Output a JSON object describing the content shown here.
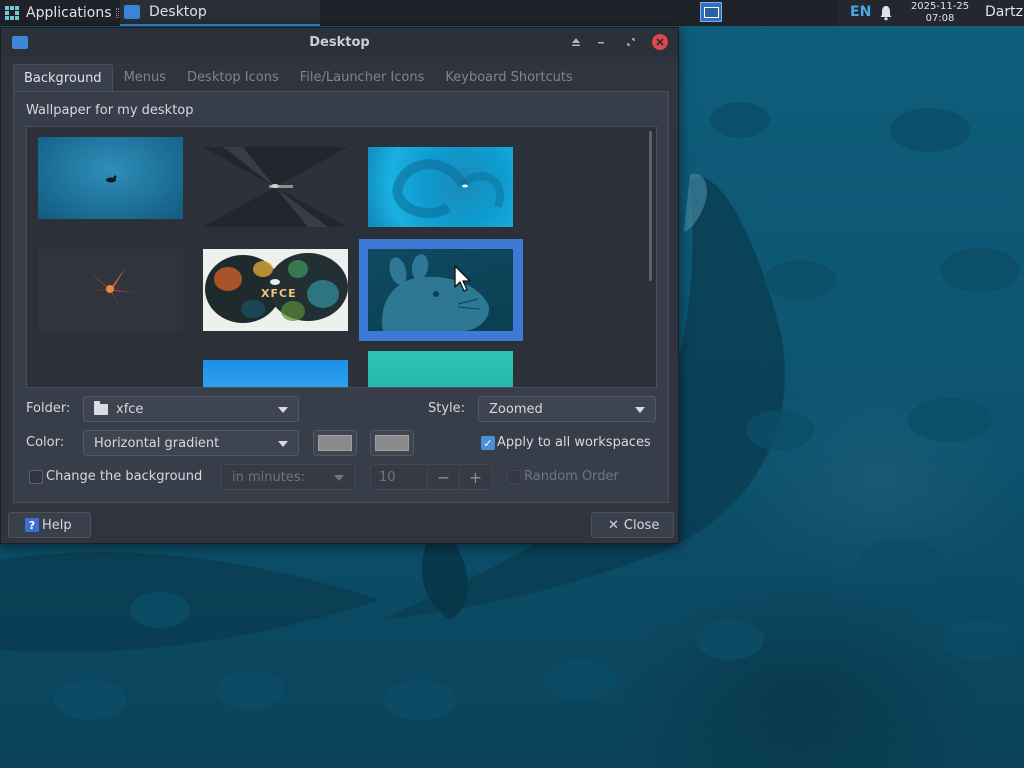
{
  "panel": {
    "applications_label": "Applications",
    "task_label": "Desktop",
    "lang": "EN",
    "clock_date": "2025-11-25",
    "clock_time": "07:08",
    "user": "Dartz"
  },
  "dialog": {
    "title": "Desktop",
    "tabs": [
      {
        "label": "Background",
        "active": true
      },
      {
        "label": "Menus",
        "active": false
      },
      {
        "label": "Desktop Icons",
        "active": false
      },
      {
        "label": "File/Launcher Icons",
        "active": false
      },
      {
        "label": "Keyboard Shortcuts",
        "active": false
      }
    ],
    "section_label": "Wallpaper for my desktop",
    "gallery": {
      "selected_index": 5,
      "thumb_caption_xfce": "XFCE"
    },
    "folder": {
      "label": "Folder:",
      "value": "xfce"
    },
    "style": {
      "label": "Style:",
      "value": "Zoomed"
    },
    "color": {
      "label": "Color:",
      "value": "Horizontal gradient",
      "color1": "#8a8a8a",
      "color2": "#8a8a8a"
    },
    "apply_all": {
      "label": "Apply to all workspaces",
      "checked": true
    },
    "change_bg": {
      "label": "Change the background",
      "checked": false,
      "interval_unit": "in minutes:",
      "interval_value": "10"
    },
    "random_order": {
      "label": "Random Order",
      "checked": false
    },
    "help_label": "Help",
    "close_label": "Close"
  },
  "colors": {
    "accent": "#3d7ad6",
    "close_button": "#e0474c",
    "panel_bg": "#1f2228",
    "dialog_bg": "#2f343f"
  }
}
